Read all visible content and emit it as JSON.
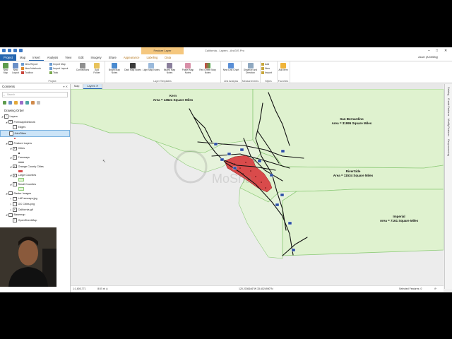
{
  "title_bar": {
    "context_tab": "Feature Layer",
    "window_title": "California - Layers - ArcGIS Pro",
    "signin": "Asser (AGMDtg)"
  },
  "tabs": [
    "Project",
    "Map",
    "Insert",
    "Analysis",
    "View",
    "Edit",
    "Imagery",
    "Share",
    "Appearance",
    "Labeling",
    "Data"
  ],
  "ribbon": {
    "project": {
      "new_map": "New Map",
      "new_layout": "New Layout",
      "new_report": "New Report",
      "new_notebook": "New Notebook",
      "toolbox": "Toolbox",
      "import_map": "Import Map",
      "import_layout": "Import Layout",
      "task": "Task",
      "connections": "Connections",
      "add_folder": "Add Folder",
      "label": "Project"
    },
    "templates": {
      "items": [
        "Bright Map Notes",
        "Dark Map Notes",
        "Light Map Notes",
        "Muted Map Notes",
        "Pastel Map Notes",
        "Red Green Map Notes"
      ],
      "label": "Layer Templates"
    },
    "link": {
      "new_link_chart": "New Link Chart",
      "label": "Link Analysis"
    },
    "measure": {
      "distance": "Distance and Direction",
      "label": "Measurements"
    },
    "styles": {
      "add": "Add",
      "new": "New",
      "import": "Import",
      "label": "Styles"
    },
    "favorites": {
      "add_item": "Add Item",
      "label": "Favorites"
    }
  },
  "contents": {
    "header": "Contents",
    "search_placeholder": "Search",
    "drawing_order": "Drawing Order",
    "items": [
      {
        "label": "Layers",
        "indent": 0,
        "checked": true,
        "expander": "◢"
      },
      {
        "label": "FreewaysNetwork",
        "indent": 1,
        "checked": true,
        "expander": "◢"
      },
      {
        "label": "Edges",
        "indent": 2,
        "checked": false,
        "expander": ""
      },
      {
        "label": "JoinCities",
        "indent": 1,
        "checked": false,
        "expander": "",
        "highlight": true
      },
      {
        "label": "Feature Layers",
        "indent": 1,
        "checked": true,
        "expander": "◢"
      },
      {
        "label": "Cities",
        "indent": 2,
        "checked": true,
        "expander": "◢"
      },
      {
        "label": "Freeways",
        "indent": 2,
        "checked": true,
        "expander": "◢"
      },
      {
        "label": "Orange County Cities",
        "indent": 2,
        "checked": true,
        "expander": "◢"
      },
      {
        "label": "Large Counties",
        "indent": 2,
        "checked": true,
        "expander": "◢"
      },
      {
        "label": "Small Counties",
        "indent": 2,
        "checked": true,
        "expander": "◢"
      },
      {
        "label": "Raster Images",
        "indent": 1,
        "checked": false,
        "expander": "◢"
      },
      {
        "label": "LAFreeways.jpg",
        "indent": 2,
        "checked": false,
        "expander": "▷"
      },
      {
        "label": "OC Cities.png",
        "indent": 2,
        "checked": false,
        "expander": "▷"
      },
      {
        "label": "California.gif",
        "indent": 2,
        "checked": true,
        "expander": "▷"
      },
      {
        "label": "Basemap",
        "indent": 1,
        "checked": false,
        "expander": "◢"
      },
      {
        "label": "OpenStreetMap",
        "indent": 2,
        "checked": true,
        "expander": ""
      }
    ]
  },
  "map_tabs": [
    "Map",
    "Layers"
  ],
  "counties": [
    {
      "name": "Kern",
      "area": "Area = 13621 Square Miles"
    },
    {
      "name": "San Bernardino",
      "area": "Area = 31995 Square Miles"
    },
    {
      "name": "RiverSide",
      "area": "Area = 11534 Square Miles"
    },
    {
      "name": "Imperial",
      "area": "Area = 7161 Square Miles"
    }
  ],
  "status": {
    "scale": "1:1,600,771",
    "coords": "120.2036166°W 33.6024950°N",
    "selected": "Selected Features: 0"
  },
  "right_panes": [
    "Catalog",
    "Create Features",
    "Modify Features",
    "Geoprocessing"
  ],
  "colors": {
    "county_fill": "#dff2cf",
    "county_stroke": "#8fcb7a",
    "oc_fill": "#d94b4b",
    "freeway": "#111111",
    "ribbon_accent": "#2566b0"
  }
}
